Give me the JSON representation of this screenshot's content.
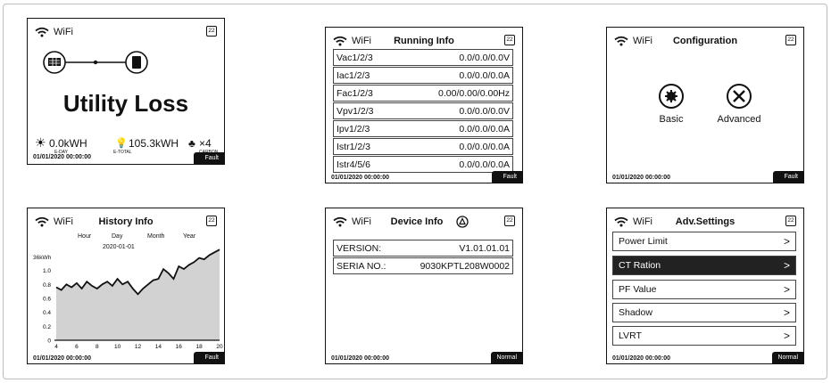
{
  "common": {
    "wifi": "WiFi",
    "battery": "22",
    "datetime": "01/01/2020  00:00:00"
  },
  "screens": {
    "utility": {
      "message": "Utility Loss",
      "eday_value": "0.0kWH",
      "eday_label": "E-DAY",
      "etotal_value": "105.3kWH",
      "etotal_label": "E-TOTAL",
      "carbon_value": "×4",
      "carbon_label": "CARBON",
      "status": "Fault"
    },
    "running": {
      "title": "Running Info",
      "rows": [
        {
          "key": "Vac1/2/3",
          "value": "0.0/0.0/0.0V"
        },
        {
          "key": "Iac1/2/3",
          "value": "0.0/0.0/0.0A"
        },
        {
          "key": "Fac1/2/3",
          "value": "0.00/0.00/0.00Hz"
        },
        {
          "key": "Vpv1/2/3",
          "value": "0.0/0.0/0.0V"
        },
        {
          "key": "Ipv1/2/3",
          "value": "0.0/0.0/0.0A"
        },
        {
          "key": "Istr1/2/3",
          "value": "0.0/0.0/0.0A"
        },
        {
          "key": "Istr4/5/6",
          "value": "0.0/0.0/0.0A"
        }
      ],
      "status": "Fault"
    },
    "config": {
      "title": "Configuration",
      "basic_label": "Basic",
      "advanced_label": "Advanced",
      "status": "Fault"
    },
    "history": {
      "title": "History Info",
      "tabs": [
        "Hour",
        "Day",
        "Month",
        "Year"
      ],
      "date": "2020-01-01",
      "unit": "36kWh",
      "status": "Fault"
    },
    "device": {
      "title": "Device Info",
      "rows": [
        {
          "key": "VERSION:",
          "value": "V1.01.01.01"
        },
        {
          "key": "SERIA NO.:",
          "value": "9030KPTL208W0002"
        }
      ],
      "status": "Normal"
    },
    "adv": {
      "title": "Adv.Settings",
      "items": [
        "Power Limit",
        "CT Ration",
        "PF Value",
        "Shadow",
        "LVRT"
      ],
      "status": "Normal"
    }
  },
  "chart_data": {
    "type": "area",
    "x_ticks": [
      "4",
      "6",
      "8",
      "10",
      "12",
      "14",
      "16",
      "18",
      "20"
    ],
    "y_ticks": [
      "0",
      "0.2",
      "0.4",
      "0.6",
      "0.8",
      "1.0"
    ],
    "xlim": [
      4,
      20
    ],
    "ylim": [
      0,
      1.2
    ],
    "x": [
      4,
      4.5,
      5,
      5.5,
      6,
      6.5,
      7,
      7.5,
      8,
      8.5,
      9,
      9.5,
      10,
      10.5,
      11,
      11.5,
      12,
      12.5,
      13,
      13.5,
      14,
      14.5,
      15,
      15.5,
      16,
      16.5,
      17,
      17.5,
      18,
      18.5,
      19,
      19.5,
      20
    ],
    "y": [
      0.76,
      0.72,
      0.8,
      0.76,
      0.82,
      0.74,
      0.84,
      0.78,
      0.74,
      0.8,
      0.84,
      0.78,
      0.88,
      0.8,
      0.84,
      0.74,
      0.66,
      0.74,
      0.8,
      0.86,
      0.88,
      1.02,
      0.96,
      0.88,
      1.06,
      1.02,
      1.08,
      1.12,
      1.18,
      1.16,
      1.22,
      1.26,
      1.3
    ]
  }
}
